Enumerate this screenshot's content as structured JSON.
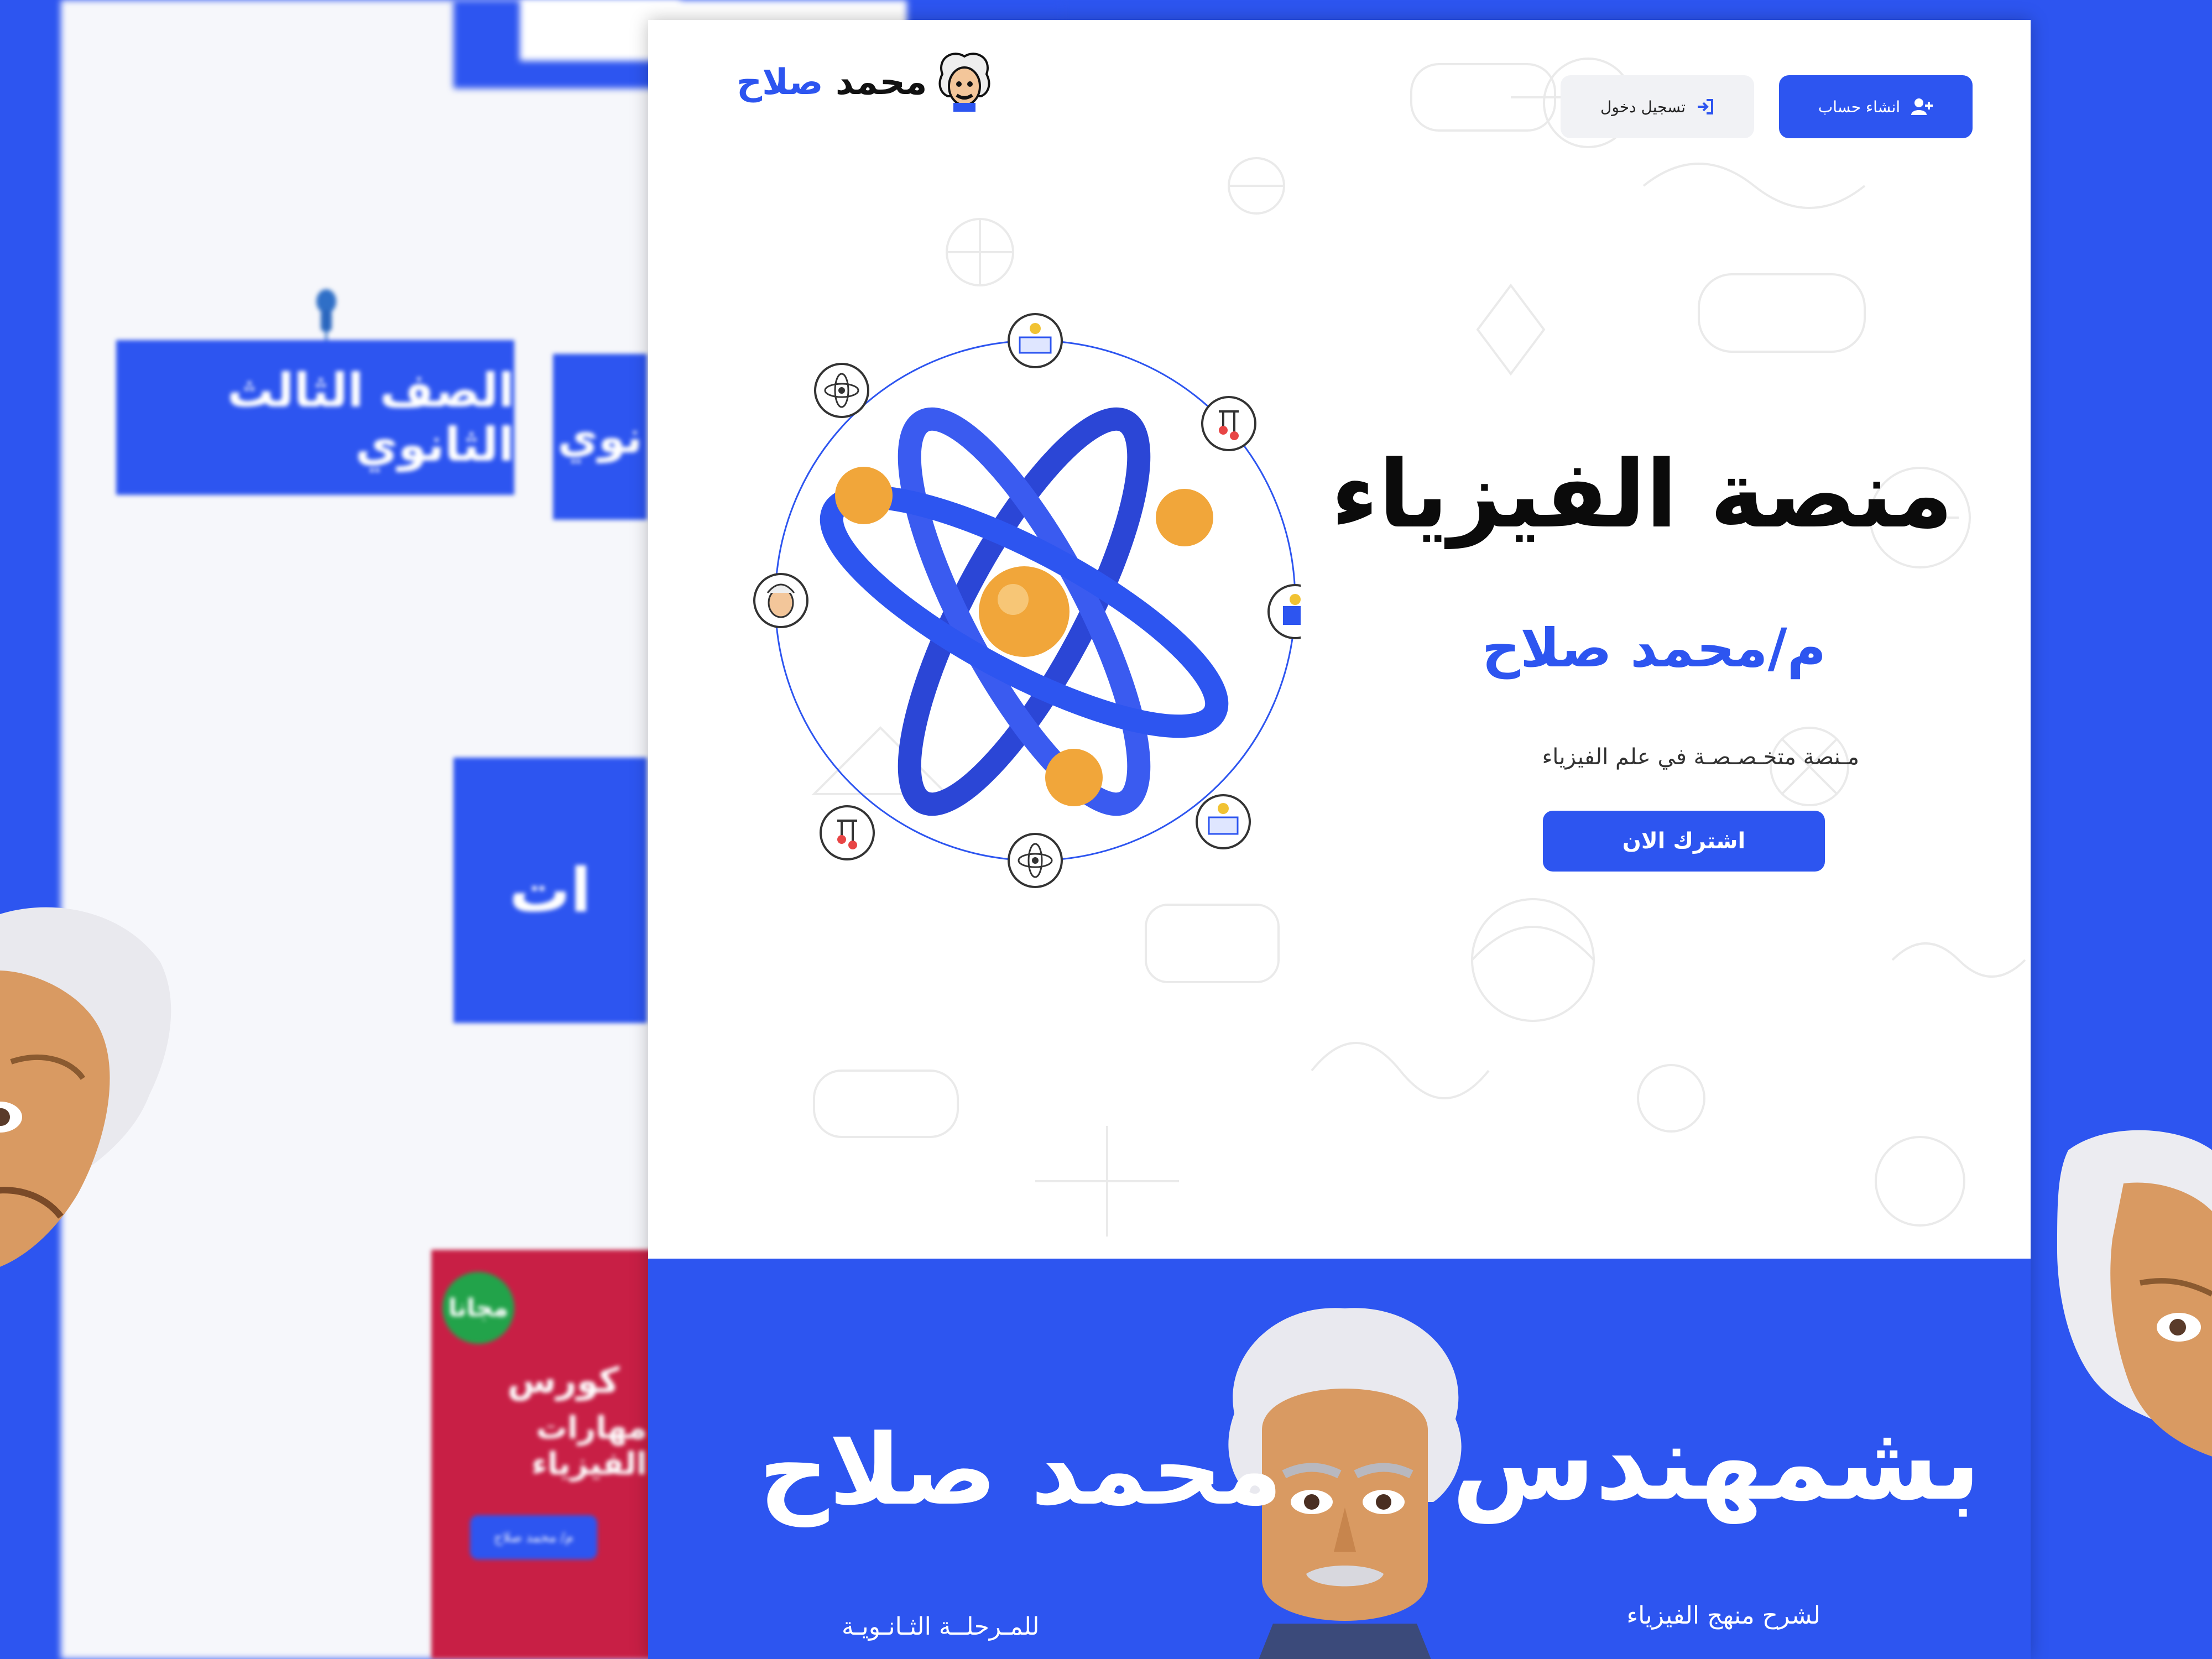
{
  "background": {
    "grade_label": "الصف الثالث الثانوي",
    "grade_label_partial": "نوي",
    "cut_label": "ات",
    "book": {
      "badge": "مجانا",
      "title_line1": "كورس",
      "title_line2": "مهارات الفيزياء",
      "author": "م/ محمد صلاح"
    }
  },
  "site": {
    "logo_part1": "محمد",
    "logo_part2": "صلاح",
    "nav": {
      "register_label": "انشاء حساب",
      "login_label": "تسجيل دخول"
    },
    "hero": {
      "title": "منصة الفيزياء",
      "teacher": "م/محمد صلاح",
      "subtitle": "مـنصة متخـصـصـة في علم الفيزياء",
      "cta": "اشترك الان"
    },
    "banner": {
      "engineer": "بشمهندس",
      "name": "محمد صلاح",
      "line1": "لشرح منهج الفيزياء",
      "line2": "للمـرحلــة الثـانـويـة"
    }
  },
  "colors": {
    "brand": "#2d55f0",
    "orb": "#f1a63a",
    "book": "#c81f45",
    "badge": "#22a34a"
  },
  "icons": [
    "user-plus-icon",
    "sign-in-icon",
    "atom-icon",
    "einstein-logo-icon"
  ]
}
